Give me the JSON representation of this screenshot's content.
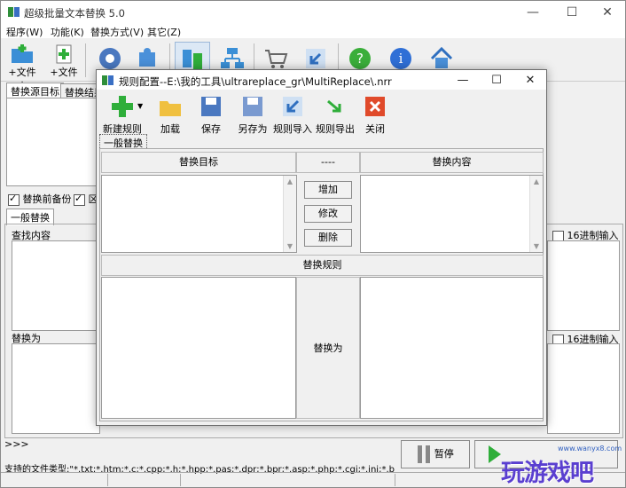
{
  "window": {
    "title": "超级批量文本替换 5.0",
    "minimize": "—",
    "maximize": "☐",
    "close": "✕"
  },
  "menu": [
    "程序(W)",
    "功能(K)",
    "替换方式(V)",
    "其它(Z)"
  ],
  "toolbar": {
    "add_folder": "+文件夹",
    "add_file": "+文件"
  },
  "left_tabs": {
    "source": "替换源目标",
    "result": "替换结果"
  },
  "options": {
    "backup_label": "替换前备份",
    "backup_checked": true,
    "second_checked": true,
    "second_label": "区"
  },
  "general_tab": "一般替换",
  "find": {
    "label": "查找内容",
    "hex_label": "16进制输入"
  },
  "replace": {
    "label": "替换为",
    "hex_label": "16进制输入"
  },
  "log_prompt": ">>>",
  "pause_button": "暂停",
  "supported_types": "支持的文件类型:\"*.txt;*.htm;*.c;*.cpp;*.h;*.hpp;*.pas;*.dpr;*.bpr;*.asp;*.php;*.cgi;*.ini;*.bat;*.inc;*.java;*.py;*.dfm",
  "watermark": {
    "url": "www.wanyx8.com",
    "text": "玩游戏吧"
  },
  "dialog": {
    "title": "规则配置--E:\\我的工具\\ultrareplace_gr\\MultiReplace\\.nrr",
    "minimize": "—",
    "maximize": "☐",
    "close": "✕",
    "tools": [
      "新建规则",
      "加载",
      "保存",
      "另存为",
      "规则导入",
      "规则导出",
      "关闭"
    ],
    "tab": "一般替换",
    "col_target": "替换目标",
    "col_sep": "----",
    "col_content": "替换内容",
    "add": "增加",
    "modify": "修改",
    "delete": "删除",
    "rules_header": "替换规则",
    "replace_with": "替换为"
  }
}
